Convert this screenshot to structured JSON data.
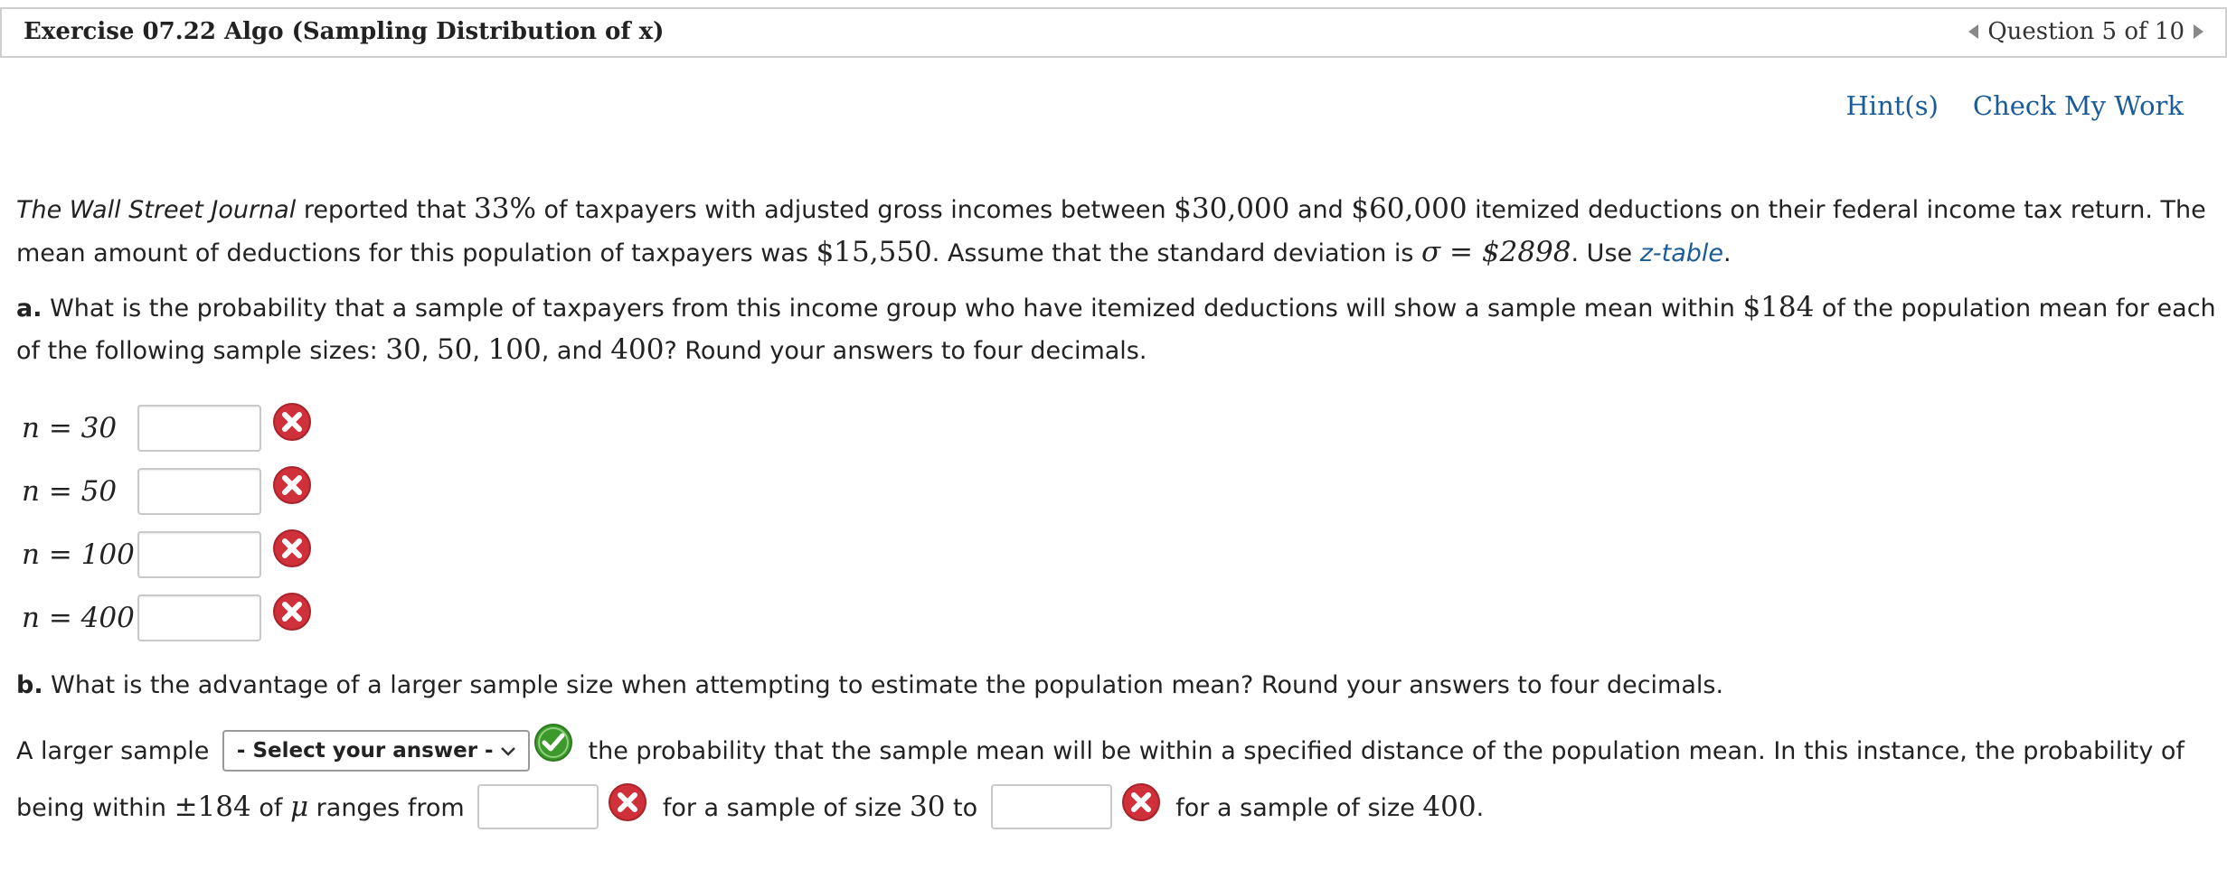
{
  "header": {
    "title": "Exercise 07.22 Algo (Sampling Distribution of x)",
    "question_nav": "Question 5 of 10"
  },
  "actions": {
    "hint": "Hint(s)",
    "check": "Check My Work"
  },
  "intro": {
    "source": "The Wall Street Journal",
    "t1": " reported that ",
    "pct": "33%",
    "t2": " of taxpayers with adjusted gross incomes between ",
    "low": "$30,000",
    "t3": " and ",
    "high": "$60,000",
    "t4": " itemized deductions on their federal income tax return. The",
    "t5": "mean amount of deductions for this population of taxpayers was ",
    "mean": "$15,550",
    "t6": ". Assume that the standard deviation is ",
    "sigma": "σ = $2898",
    "t7": ". Use ",
    "ztable": "z-table",
    "t8": "."
  },
  "part_a": {
    "label": "a.",
    "t1": " What is the probability that a sample of taxpayers from this income group who have itemized deductions will show a sample mean within ",
    "within": "$184",
    "t2": " of the population mean for each",
    "t3": "of the following sample sizes: ",
    "s1": "30",
    "c1": ", ",
    "s2": "50",
    "c2": ", ",
    "s3": "100",
    "c3": ", and ",
    "s4": "400",
    "t4": "? Round your answers to four decimals.",
    "rows": [
      {
        "label": "n = 30",
        "value": ""
      },
      {
        "label": "n = 50",
        "value": ""
      },
      {
        "label": "n = 100",
        "value": ""
      },
      {
        "label": "n = 400",
        "value": ""
      }
    ]
  },
  "part_b": {
    "label": "b.",
    "question": " What is the advantage of a larger sample size when attempting to estimate the population mean? Round your answers to four decimals.",
    "t1": "A larger sample ",
    "select_value": "- Select your answer -",
    "t2": " the probability that the sample mean will be within a specified distance of the population mean. In this instance, the probability of",
    "t3": "being within ",
    "pm": "±184",
    "t4": " of ",
    "mu": "μ",
    "t5": " ranges from ",
    "t6": " for a sample of size ",
    "n30": "30",
    "t7": " to ",
    "t8": " for a sample of size ",
    "n400": "400",
    "t9": "."
  },
  "colors": {
    "link": "#1a5b9a",
    "error": "#d0303a",
    "correct": "#3c9a2c"
  }
}
